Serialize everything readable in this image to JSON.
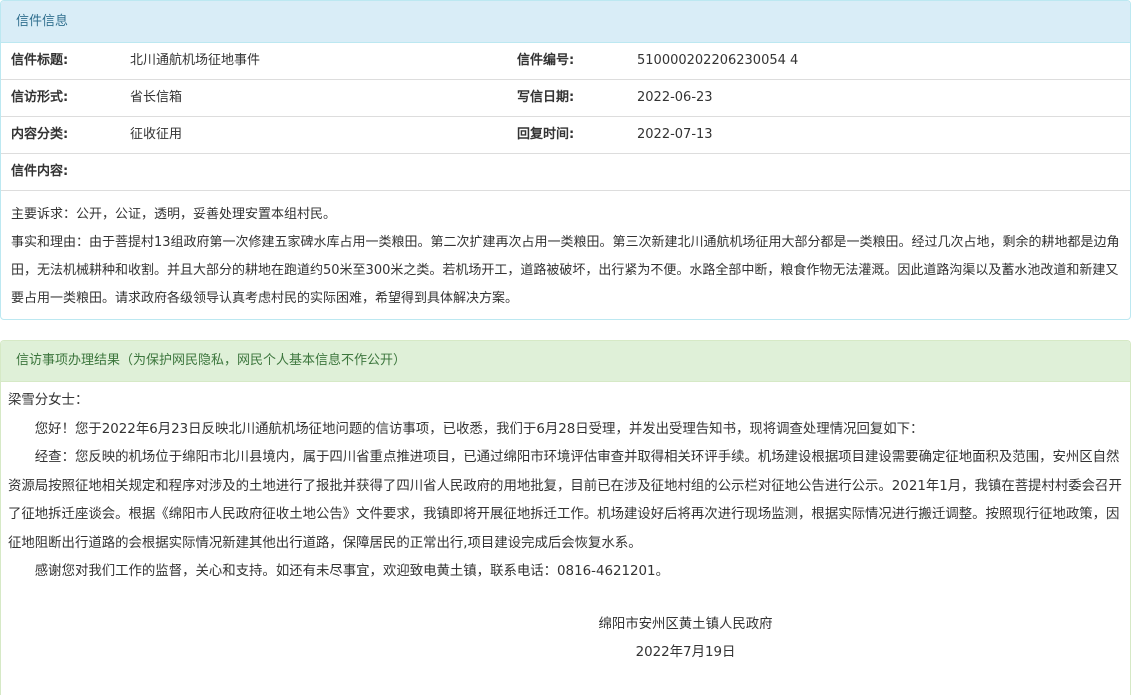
{
  "info_panel": {
    "heading": "信件信息",
    "rows": [
      {
        "l1": "信件标题:",
        "v1": "北川通航机场征地事件",
        "l2": "信件编号:",
        "v2": "510000202206230054 4"
      },
      {
        "l1": "信访形式:",
        "v1": "省长信箱",
        "l2": "写信日期:",
        "v2": "2022-06-23"
      },
      {
        "l1": "内容分类:",
        "v1": "征收征用",
        "l2": "回复时间:",
        "v2": "2022-07-13"
      }
    ],
    "content_label": "信件内容:",
    "content_paragraphs": [
      "主要诉求：公开，公证，透明，妥善处理安置本组村民。",
      "事实和理由：由于菩提村13组政府第一次修建五家碑水库占用一类粮田。第二次扩建再次占用一类粮田。第三次新建北川通航机场征用大部分都是一类粮田。经过几次占地，剩余的耕地都是边角田，无法机械耕种和收割。并且大部分的耕地在跑道约50米至300米之类。若机场开工，道路被破坏，出行紧为不便。水路全部中断，粮食作物无法灌溉。因此道路沟渠以及蓄水池改道和新建又要占用一类粮田。请求政府各级领导认真考虑村民的实际困难，希望得到具体解决方案。"
    ]
  },
  "result_panel": {
    "heading": "信访事项办理结果（为保护网民隐私，网民个人基本信息不作公开）",
    "salutation": "梁雪分女士：",
    "paragraphs": [
      "您好！您于2022年6月23日反映北川通航机场征地问题的信访事项，已收悉，我们于6月28日受理，并发出受理告知书，现将调查处理情况回复如下：",
      "经查：您反映的机场位于绵阳市北川县境内，属于四川省重点推进项目，已通过绵阳市环境评估审查并取得相关环评手续。机场建设根据项目建设需要确定征地面积及范围，安州区自然资源局按照征地相关规定和程序对涉及的土地进行了报批并获得了四川省人民政府的用地批复，目前已在涉及征地村组的公示栏对征地公告进行公示。2021年1月，我镇在菩提村村委会召开了征地拆迁座谈会。根据《绵阳市人民政府征收土地公告》文件要求，我镇即将开展征地拆迁工作。机场建设好后将再次进行现场监测，根据实际情况进行搬迁调整。按照现行征地政策，因征地阻断出行道路的会根据实际情况新建其他出行道路，保障居民的正常出行,项目建设完成后会恢复水系。",
      "感谢您对我们工作的监督，关心和支持。如还有未尽事宜，欢迎致电黄土镇，联系电话：0816-4621201。"
    ],
    "signature_org": "绵阳市安州区黄土镇人民政府",
    "signature_date": "2022年7月19日"
  }
}
